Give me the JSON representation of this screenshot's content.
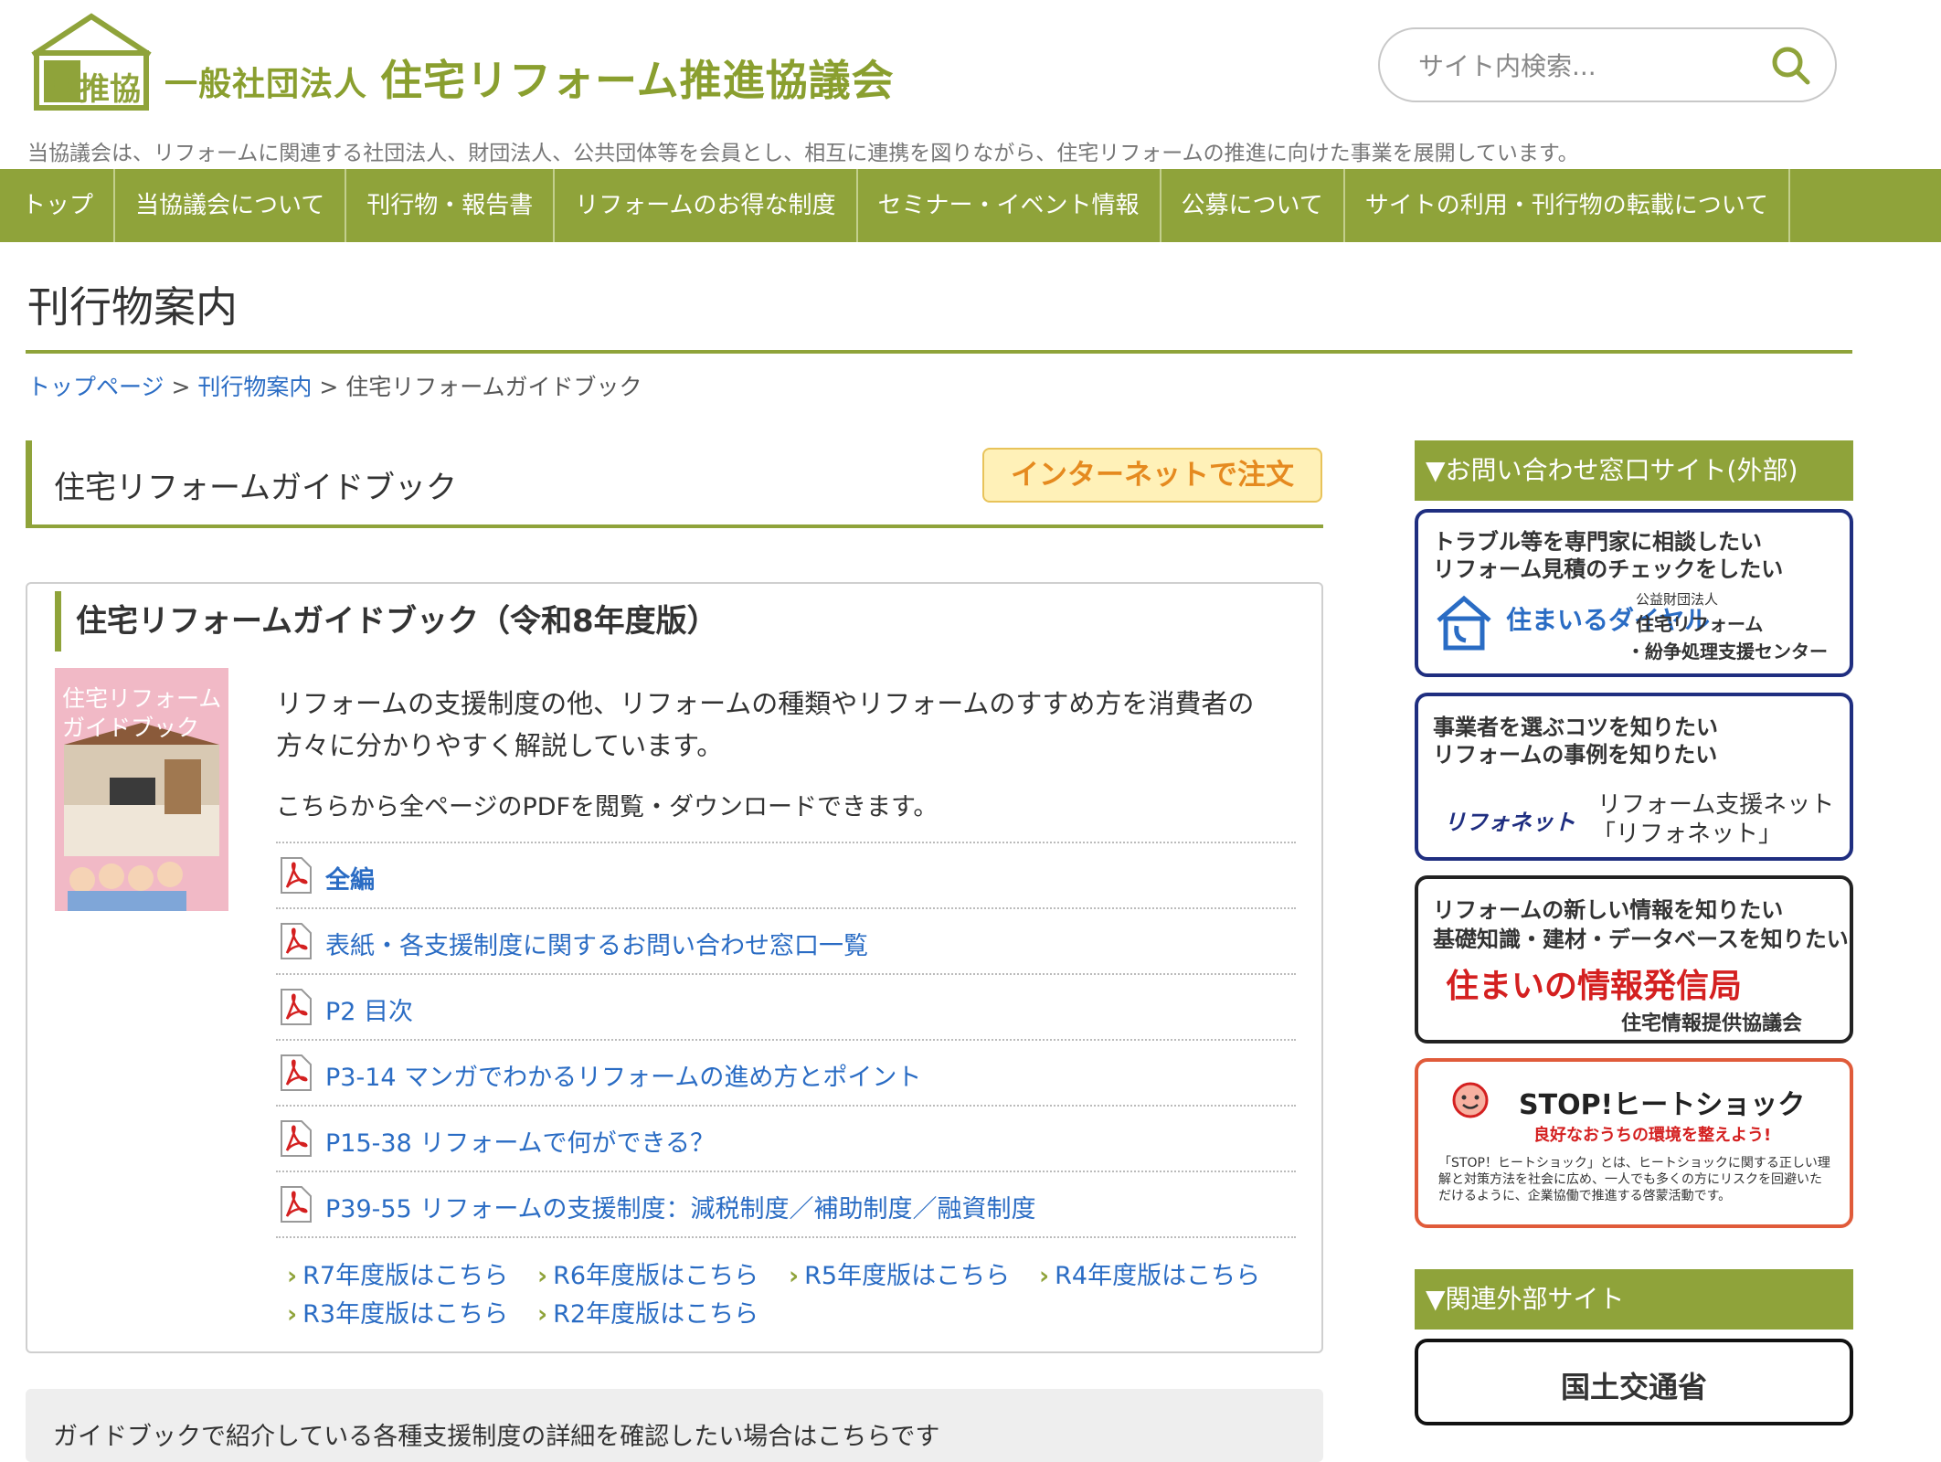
{
  "header": {
    "logo_text": "リ推協",
    "org_prefix": "一般社団法人",
    "org_name": "住宅リフォーム推進協議会",
    "search_placeholder": "サイト内検索...",
    "tagline": "当協議会は、リフォームに関連する社団法人、財団法人、公共団体等を会員とし、相互に連携を図りながら、住宅リフォームの推進に向けた事業を展開しています。"
  },
  "nav": [
    "トップ",
    "当協議会について",
    "刊行物・報告書",
    "リフォームのお得な制度",
    "セミナー・イベント情報",
    "公募について",
    "サイトの利用・刊行物の転載について"
  ],
  "page_title": "刊行物案内",
  "breadcrumb": {
    "home": "トップページ",
    "parent": "刊行物案内",
    "current": "住宅リフォームガイドブック",
    "sep": ">"
  },
  "section": {
    "title": "住宅リフォームガイドブック",
    "order_button": "インターネットで注文"
  },
  "card": {
    "title": "住宅リフォームガイドブック（令和8年度版）",
    "cover_title_line1": "住宅リフォーム",
    "cover_title_line2": "ガイドブック",
    "description": "リフォームの支援制度の他、リフォームの種類やリフォームのすすめ方を消費者の方々に分かりやすく解説しています。",
    "pdf_note": "こちらから全ページのPDFを閲覧・ダウンロードできます。",
    "pdf_links": [
      {
        "label": "全編",
        "bold": true
      },
      {
        "label": "表紙・各支援制度に関するお問い合わせ窓口一覧",
        "bold": false
      },
      {
        "label": "P2 目次",
        "bold": false
      },
      {
        "label": "P3-14 マンガでわかるリフォームの進め方とポイント",
        "bold": false
      },
      {
        "label": "P15-38 リフォームで何ができる？",
        "bold": false
      },
      {
        "label": "P39-55 リフォームの支援制度：減税制度／補助制度／融資制度",
        "bold": false
      }
    ],
    "previous_editions": [
      "R7年度版はこちら",
      "R6年度版はこちら",
      "R5年度版はこちら",
      "R4年度版はこちら",
      "R3年度版はこちら",
      "R2年度版はこちら"
    ]
  },
  "bottom_note": "ガイドブックで紹介している各種支援制度の詳細を確認したい場合はこちらです",
  "sidebar": {
    "contact_heading": "▼お問い合わせ窓口サイト(外部)",
    "banners": [
      {
        "line1": "トラブル等を専門家に相談したい",
        "line2": "リフォーム見積のチェックをしたい",
        "brand": "住まいるダイヤル",
        "org_small": "公益財団法人",
        "org_line1": "住宅リフォーム",
        "org_line2": "・紛争処理支援センター"
      },
      {
        "line1": "事業者を選ぶコツを知りたい",
        "line2": "リフォームの事例を知りたい",
        "brand": "リフォネット",
        "org_line1": "リフォーム支援ネット",
        "org_line2": "「リフォネット」"
      },
      {
        "line1": "リフォームの新しい情報を知りたい",
        "line2": "基礎知識・建材・データベースを知りたい",
        "brand": "住まいの情報発信局",
        "org_line1": "住宅情報提供協議会"
      },
      {
        "brand": "STOP!ヒートショック",
        "subtitle": "良好なおうちの環境を整えよう!",
        "desc": "「STOP！ヒートショック」とは、ヒートショックに関する正しい理解と対策方法を社会に広め、一人でも多くの方にリスクを回避いただけるように、企業協働で推進する啓蒙活動です。"
      }
    ],
    "related_heading": "▼関連外部サイト",
    "related_links": [
      "国土交通省"
    ]
  },
  "colors": {
    "brand_green": "#8fa33a",
    "link_blue": "#2a6cc4",
    "order_orange": "#e58a1f",
    "banner_navy": "#1f2e80"
  }
}
